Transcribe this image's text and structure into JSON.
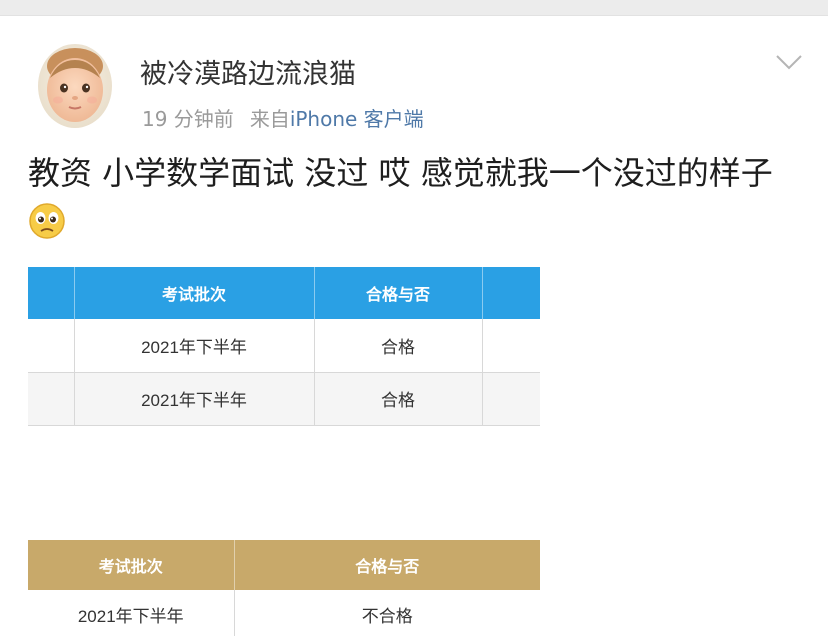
{
  "post": {
    "username": "被冷漠路边流浪猫",
    "time_ago": "19 分钟前",
    "source_label": "来自",
    "source_device": "iPhone 客户端",
    "text": "教资 小学数学面试 没过 哎 感觉就我一个没过的样子"
  },
  "icons": {
    "avatar": "baby-avatar",
    "dropdown": "chevron-down-icon",
    "emoji": "sad-face-emoji"
  },
  "table_top": {
    "header": {
      "batch": "考试批次",
      "result": "合格与否"
    },
    "rows": [
      {
        "batch": "2021年下半年",
        "result": "合格"
      },
      {
        "batch": "2021年下半年",
        "result": "合格"
      }
    ]
  },
  "table_bottom": {
    "header": {
      "batch": "考试批次",
      "result": "合格与否"
    },
    "rows": [
      {
        "batch": "2021年下半年",
        "result": "不合格"
      }
    ]
  },
  "colors": {
    "top_header": "#2aa0e4",
    "bottom_header": "#c8a96a",
    "device_link": "#4f79a8"
  }
}
